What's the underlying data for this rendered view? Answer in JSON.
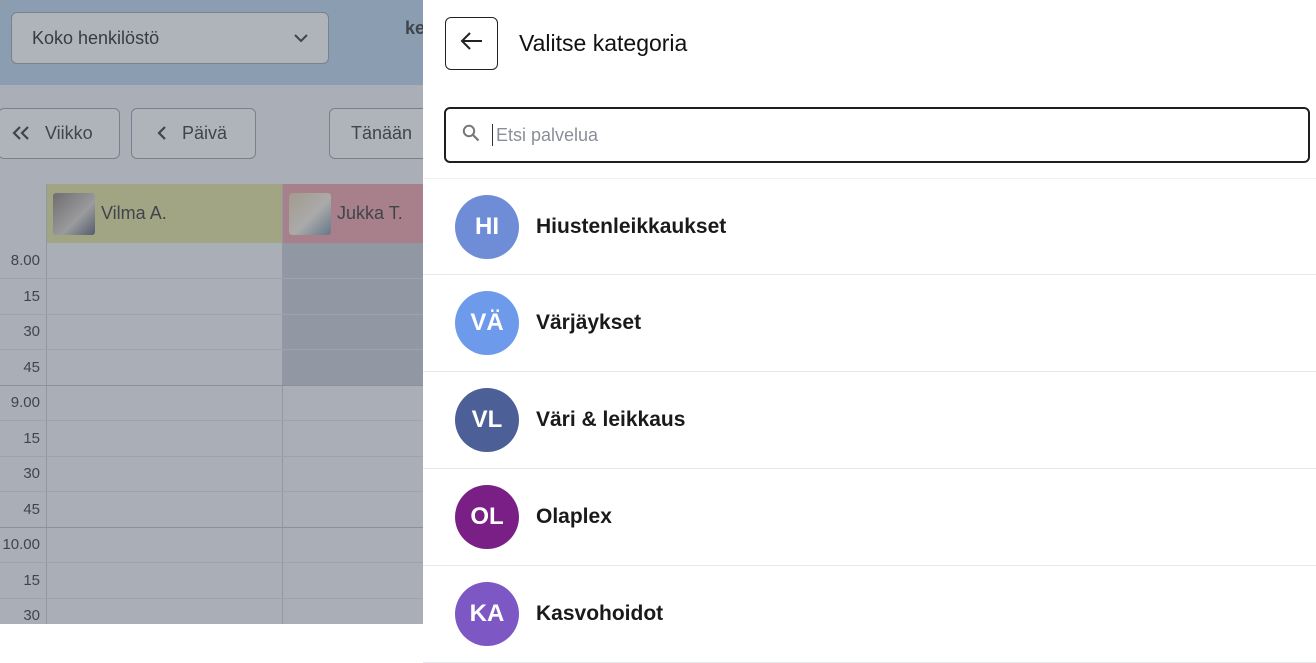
{
  "calendar": {
    "staff_select": "Koko henkilöstö",
    "header_partial": "ke",
    "nav": {
      "week": "Viikko",
      "day": "Päivä",
      "today": "Tänään"
    },
    "staff": [
      {
        "name": "Vilma A.",
        "color": "#e5e59a"
      },
      {
        "name": "Jukka T.",
        "color": "#f1a1a8"
      }
    ],
    "times": [
      "8.00",
      "15",
      "30",
      "45",
      "9.00",
      "15",
      "30",
      "45",
      "10.00",
      "15",
      "30"
    ]
  },
  "panel": {
    "title": "Valitse kategoria",
    "search_placeholder": "Etsi palvelua",
    "categories": [
      {
        "initials": "HI",
        "label": "Hiustenleikkaukset",
        "color": "#6f8dd6"
      },
      {
        "initials": "VÄ",
        "label": "Värjäykset",
        "color": "#6e9aec"
      },
      {
        "initials": "VL",
        "label": "Väri & leikkaus",
        "color": "#4d5f97"
      },
      {
        "initials": "OL",
        "label": "Olaplex",
        "color": "#7a1f86"
      },
      {
        "initials": "KA",
        "label": "Kasvohoidot",
        "color": "#7d58c4"
      }
    ]
  }
}
